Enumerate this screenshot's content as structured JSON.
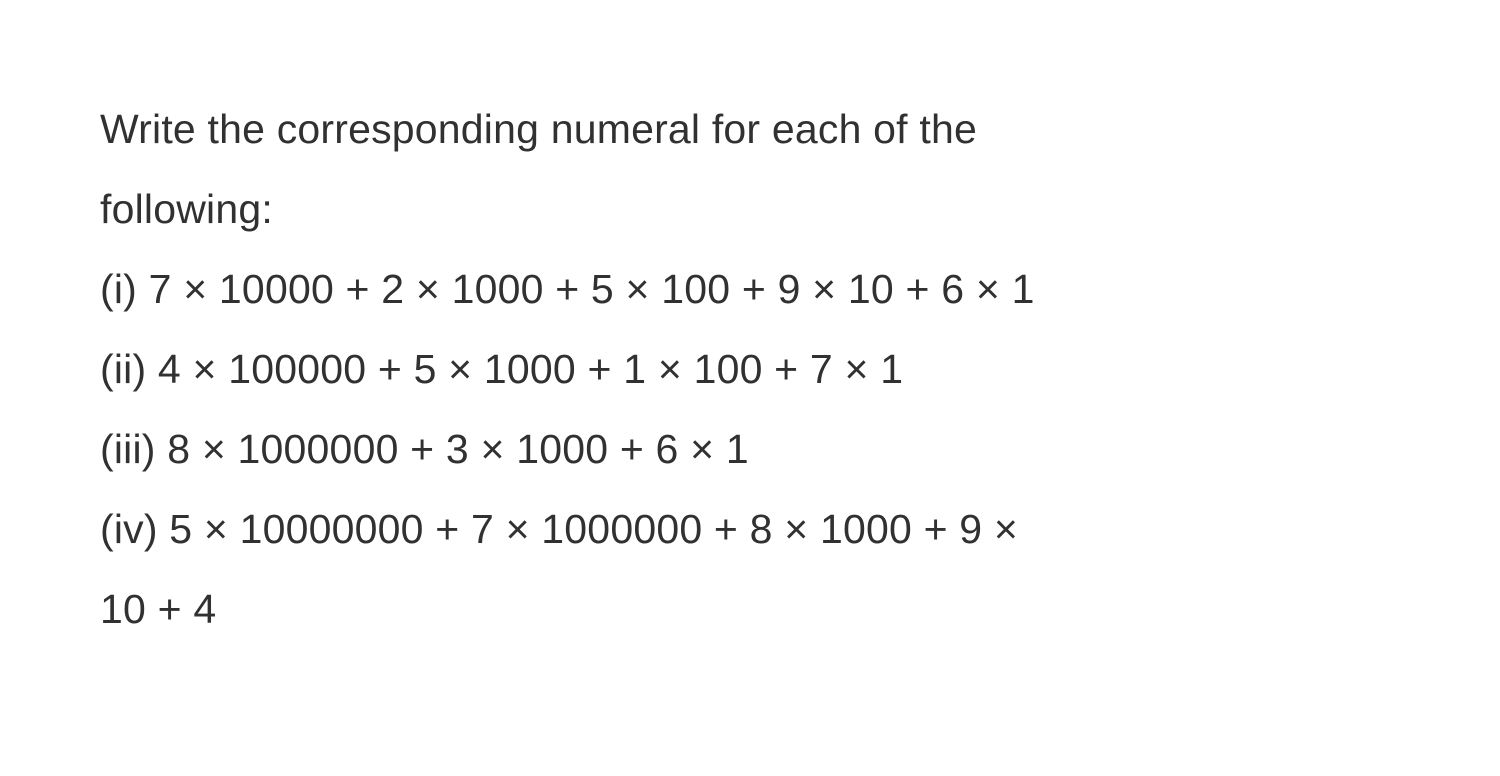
{
  "question": {
    "heading_line1": "Write the corresponding numeral for each of the",
    "heading_line2": "following:",
    "items": [
      "(i) 7 × 10000 + 2 × 1000 + 5 × 100 + 9 × 10 + 6 × 1",
      "(ii) 4 × 100000 + 5 × 1000 + 1 × 100 + 7 × 1",
      "(iii) 8 × 1000000 + 3 × 1000 + 6 × 1",
      "(iv) 5 × 10000000 + 7 × 1000000 + 8 × 1000 + 9 ×",
      "10 + 4"
    ]
  }
}
